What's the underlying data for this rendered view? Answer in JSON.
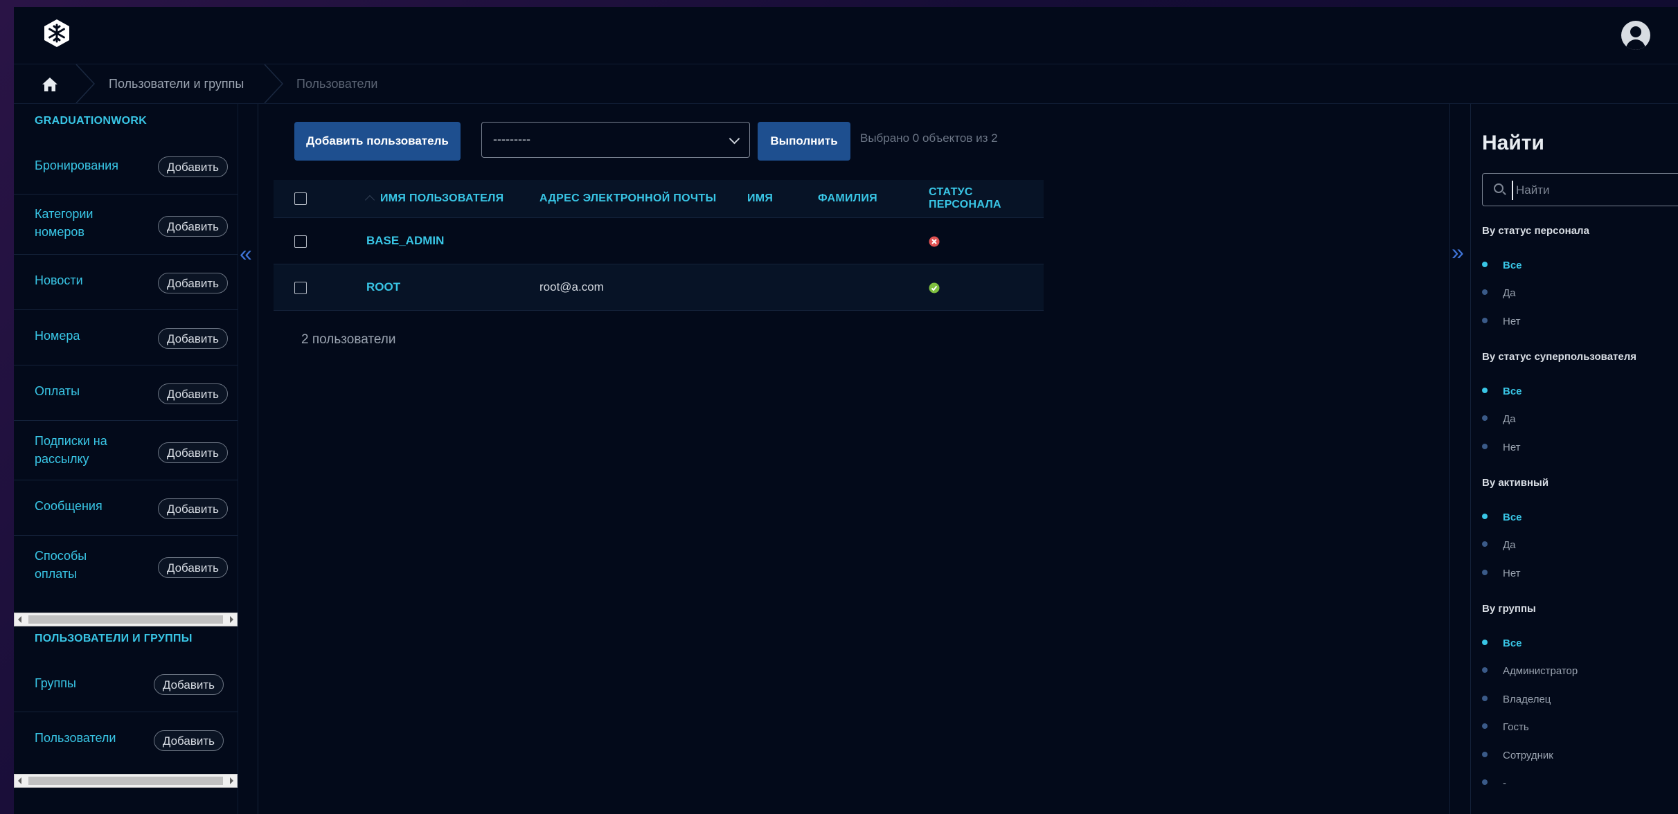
{
  "header": {
    "logo_icon": "snowflake-hexagon-logo",
    "user_icon": "user-avatar-icon"
  },
  "breadcrumb": {
    "home_icon": "home-icon",
    "items": [
      "Пользователи и группы",
      "Пользователи"
    ]
  },
  "sidebar": {
    "modules": [
      {
        "title": "GRADUATIONWORK",
        "items": [
          {
            "label": "Бронирования",
            "add": "Добавить"
          },
          {
            "label": "Категории номеров",
            "add": "Добавить"
          },
          {
            "label": "Новости",
            "add": "Добавить"
          },
          {
            "label": "Номера",
            "add": "Добавить"
          },
          {
            "label": "Оплаты",
            "add": "Добавить"
          },
          {
            "label": "Подписки на рассылку",
            "add": "Добавить"
          },
          {
            "label": "Сообщения",
            "add": "Добавить"
          },
          {
            "label": "Способы оплаты",
            "add": "Добавить"
          }
        ]
      },
      {
        "title": "ПОЛЬЗОВАТЕЛИ И ГРУППЫ",
        "items": [
          {
            "label": "Группы",
            "add": "Добавить"
          },
          {
            "label": "Пользователи",
            "add": "Добавить"
          }
        ]
      }
    ]
  },
  "toolbar": {
    "add_user": "Добавить пользователь",
    "action_select": "---------",
    "run": "Выполнить",
    "selected_count": "Выбрано 0 объектов из 2"
  },
  "table": {
    "columns": [
      "ИМЯ ПОЛЬЗОВАТЕЛЯ",
      "АДРЕС ЭЛЕКТРОННОЙ ПОЧТЫ",
      "ИМЯ",
      "ФАМИЛИЯ",
      "СТАТУС ПЕРСОНАЛА"
    ],
    "rows": [
      {
        "username": "BASE_ADMIN",
        "email": "",
        "first_name": "",
        "last_name": "",
        "staff": false
      },
      {
        "username": "ROOT",
        "email": "root@a.com",
        "first_name": "",
        "last_name": "",
        "staff": true
      }
    ],
    "count_text": "2 пользователи"
  },
  "filter": {
    "title": "Найти",
    "search_placeholder": "Найти",
    "groups": [
      {
        "title": "By статус персонала",
        "options": [
          "Все",
          "Да",
          "Нет"
        ],
        "selected": 0
      },
      {
        "title": "By статус суперпользователя",
        "options": [
          "Все",
          "Да",
          "Нет"
        ],
        "selected": 0
      },
      {
        "title": "By активный",
        "options": [
          "Все",
          "Да",
          "Нет"
        ],
        "selected": 0
      },
      {
        "title": "By группы",
        "options": [
          "Все",
          "Администратор",
          "Владелец",
          "Гость",
          "Сотрудник",
          "-"
        ],
        "selected": 0
      }
    ]
  },
  "colors": {
    "accent": "#39c6e6",
    "primary_button": "#1e4f8f",
    "background": "#030a1a",
    "status_no": "#e05252",
    "status_yes": "#7fbf3f"
  }
}
